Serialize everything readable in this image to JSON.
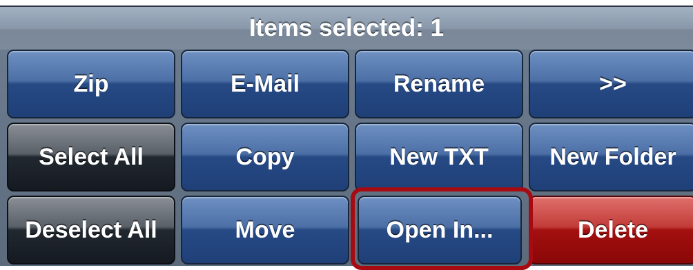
{
  "header": {
    "title": "Items selected: 1"
  },
  "buttons": {
    "zip": "Zip",
    "email": "E-Mail",
    "rename": "Rename",
    "more": ">>",
    "select_all": "Select All",
    "copy": "Copy",
    "new_txt": "New TXT",
    "new_folder": "New Folder",
    "deselect_all": "Deselect All",
    "move": "Move",
    "open_in": "Open In...",
    "delete": "Delete"
  },
  "colors": {
    "header_text": "#ffffff",
    "button_blue": "#274a85",
    "button_black": "#151a21",
    "button_red": "#a3100f",
    "highlight_outline": "#a80a12"
  }
}
